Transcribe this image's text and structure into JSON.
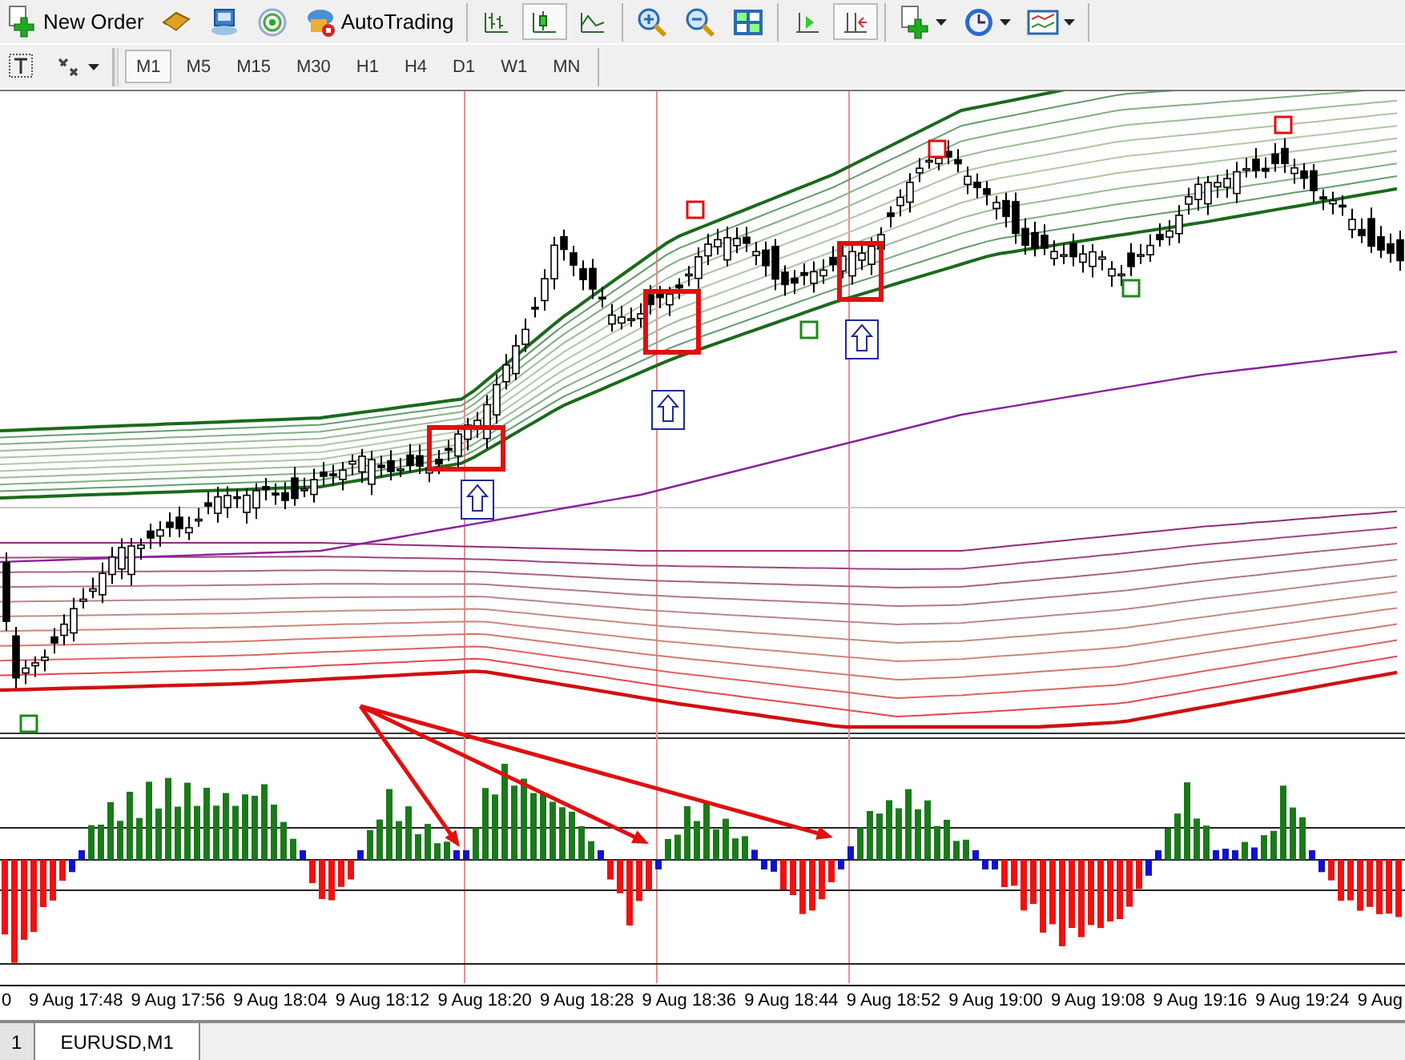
{
  "toolbar": {
    "new_order": {
      "label": "New Order"
    },
    "autotrading": {
      "label": "AutoTrading"
    },
    "chart_types": [
      {
        "kind": "bars",
        "selected": false
      },
      {
        "kind": "candles",
        "selected": true
      },
      {
        "kind": "line",
        "selected": false
      }
    ],
    "scroll_modes": [
      {
        "kind": "autoscroll",
        "selected": false
      },
      {
        "kind": "shift",
        "selected": true
      }
    ]
  },
  "timeframes": [
    {
      "label": "M1",
      "selected": true
    },
    {
      "label": "M5",
      "selected": false
    },
    {
      "label": "M15",
      "selected": false
    },
    {
      "label": "M30",
      "selected": false
    },
    {
      "label": "H1",
      "selected": false
    },
    {
      "label": "H4",
      "selected": false
    },
    {
      "label": "D1",
      "selected": false
    },
    {
      "label": "W1",
      "selected": false
    },
    {
      "label": "MN",
      "selected": false
    }
  ],
  "chart": {
    "time_axis": [
      "0",
      "9 Aug 17:48",
      "9 Aug 17:56",
      "9 Aug 18:04",
      "9 Aug 18:12",
      "9 Aug 18:20",
      "9 Aug 18:28",
      "9 Aug 18:36",
      "9 Aug 18:44",
      "9 Aug 18:52",
      "9 Aug 19:00",
      "9 Aug 19:08",
      "9 Aug 19:16",
      "9 Aug 19:24",
      "9 Aug"
    ]
  },
  "tabs": [
    {
      "label": "1",
      "selected": false
    },
    {
      "label": "EURUSD,M1",
      "selected": true
    }
  ]
}
